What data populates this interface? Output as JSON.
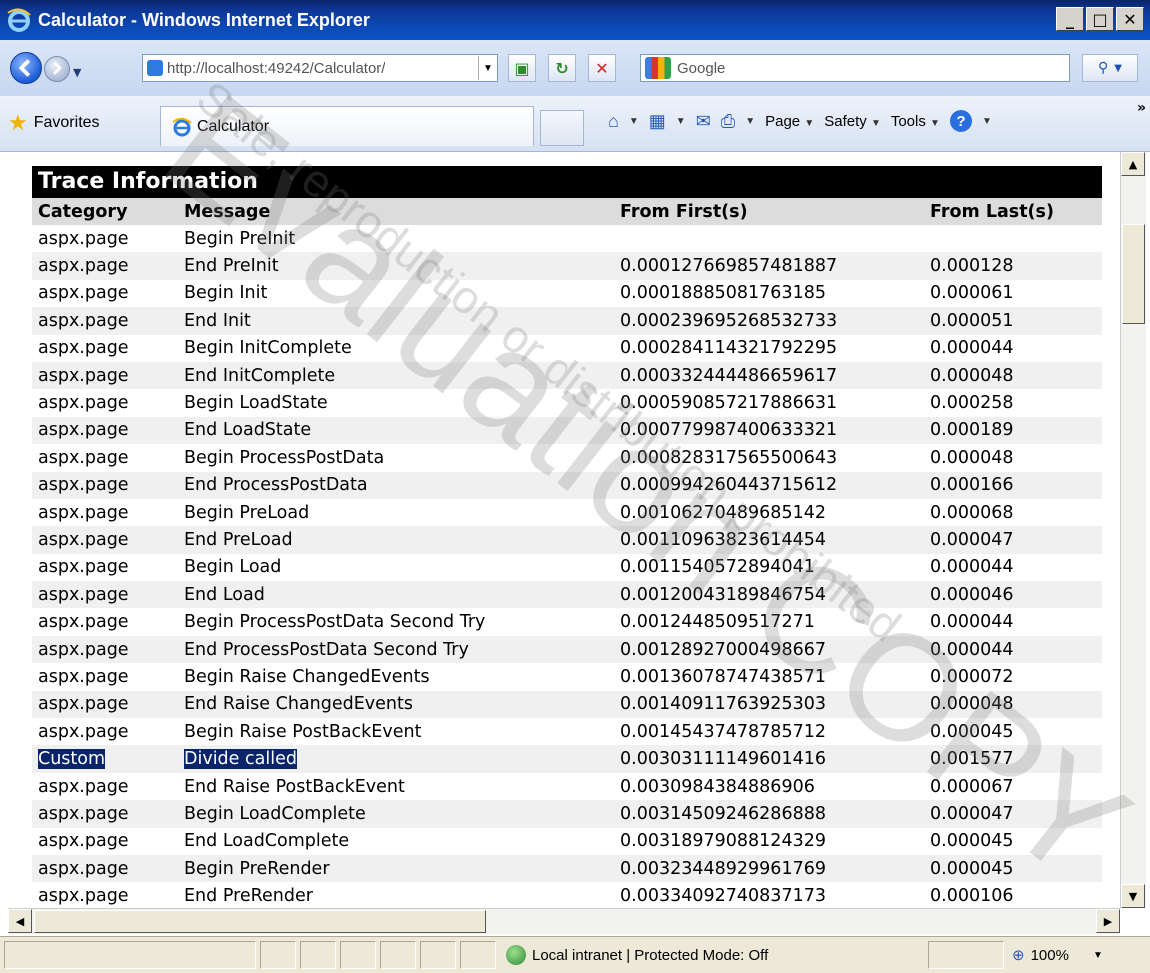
{
  "window": {
    "title": "Calculator - Windows Internet Explorer"
  },
  "address": {
    "url": "http://localhost:49242/Calculator/"
  },
  "search": {
    "placeholder": "Google"
  },
  "favorites": {
    "label": "Favorites"
  },
  "tab": {
    "label": "Calculator"
  },
  "commands": {
    "page": "Page",
    "safety": "Safety",
    "tools": "Tools"
  },
  "trace": {
    "title": "Trace Information",
    "headers": [
      "Category",
      "Message",
      "From First(s)",
      "From Last(s)"
    ],
    "rows": [
      [
        "aspx.page",
        "Begin PreInit",
        "",
        ""
      ],
      [
        "aspx.page",
        "End PreInit",
        "0.000127669857481887",
        "0.000128"
      ],
      [
        "aspx.page",
        "Begin Init",
        "0.00018885081763185",
        "0.000061"
      ],
      [
        "aspx.page",
        "End Init",
        "0.000239695268532733",
        "0.000051"
      ],
      [
        "aspx.page",
        "Begin InitComplete",
        "0.000284114321792295",
        "0.000044"
      ],
      [
        "aspx.page",
        "End InitComplete",
        "0.000332444486659617",
        "0.000048"
      ],
      [
        "aspx.page",
        "Begin LoadState",
        "0.000590857217886631",
        "0.000258"
      ],
      [
        "aspx.page",
        "End LoadState",
        "0.000779987400633321",
        "0.000189"
      ],
      [
        "aspx.page",
        "Begin ProcessPostData",
        "0.000828317565500643",
        "0.000048"
      ],
      [
        "aspx.page",
        "End ProcessPostData",
        "0.000994260443715612",
        "0.000166"
      ],
      [
        "aspx.page",
        "Begin PreLoad",
        "0.00106270489685142",
        "0.000068"
      ],
      [
        "aspx.page",
        "End PreLoad",
        "0.00110963823614454",
        "0.000047"
      ],
      [
        "aspx.page",
        "Begin Load",
        "0.0011540572894041",
        "0.000044"
      ],
      [
        "aspx.page",
        "End Load",
        "0.00120043189846754",
        "0.000046"
      ],
      [
        "aspx.page",
        "Begin ProcessPostData Second Try",
        "0.0012448509517271",
        "0.000044"
      ],
      [
        "aspx.page",
        "End ProcessPostData Second Try",
        "0.00128927000498667",
        "0.000044"
      ],
      [
        "aspx.page",
        "Begin Raise ChangedEvents",
        "0.00136078747438571",
        "0.000072"
      ],
      [
        "aspx.page",
        "End Raise ChangedEvents",
        "0.00140911763925303",
        "0.000048"
      ],
      [
        "aspx.page",
        "Begin Raise PostBackEvent",
        "0.00145437478785712",
        "0.000045"
      ],
      [
        "Custom",
        "Divide called",
        "0.00303111149601416",
        "0.001577"
      ],
      [
        "aspx.page",
        "End Raise PostBackEvent",
        "0.0030984384886906",
        "0.000067"
      ],
      [
        "aspx.page",
        "Begin LoadComplete",
        "0.00314509246286888",
        "0.000047"
      ],
      [
        "aspx.page",
        "End LoadComplete",
        "0.00318979088124329",
        "0.000045"
      ],
      [
        "aspx.page",
        "Begin PreRender",
        "0.00323448929961769",
        "0.000045"
      ],
      [
        "aspx.page",
        "End PreRender",
        "0.00334092740837173",
        "0.000106"
      ]
    ],
    "selected_row": 19
  },
  "status": {
    "zone": "Local intranet | Protected Mode: Off",
    "zoom": "100%"
  },
  "watermark": {
    "line1": "Evaluation COPY",
    "line2": "Sale, reproduction or distribution prohibited"
  },
  "colors": {
    "titlebar": "#0b55c9",
    "selection": "#0a246a",
    "header_bg": "#dcdcdc",
    "alt_row": "#f0f0f0"
  }
}
